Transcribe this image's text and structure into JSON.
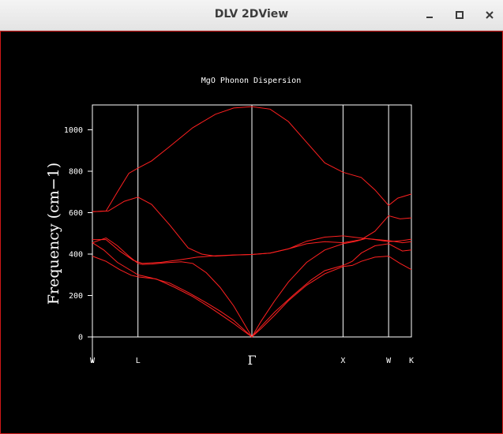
{
  "window": {
    "title": "DLV 2DView",
    "controls": {
      "minimize": "minimize-icon",
      "maximize": "maximize-icon",
      "close": "close-icon"
    }
  },
  "colors": {
    "background": "#000000",
    "axes": "#ffffff",
    "series": "#ff2020",
    "frame_border": "#d01818"
  },
  "chart_data": {
    "type": "line",
    "title": "MgO Phonon Dispersion",
    "xlabel": "",
    "ylabel": "Frequency (cm−1)",
    "xlim": [
      0,
      7
    ],
    "ylim": [
      0,
      1120
    ],
    "yticks": [
      0,
      200,
      400,
      600,
      800,
      1000
    ],
    "grid": false,
    "high_symmetry_points": [
      {
        "label": "W",
        "x": 0
      },
      {
        "label": "L",
        "x": 1
      },
      {
        "label": "Γ",
        "x": 3.5
      },
      {
        "label": "X",
        "x": 5.5
      },
      {
        "label": "W",
        "x": 6.5
      },
      {
        "label": "K",
        "x": 7
      }
    ],
    "series": [
      {
        "values": [
          [
            0,
            605
          ],
          [
            0.3,
            608
          ],
          [
            0.55,
            700
          ],
          [
            0.8,
            790
          ],
          [
            1,
            815
          ],
          [
            1.3,
            850
          ],
          [
            1.7,
            920
          ],
          [
            2.2,
            1010
          ],
          [
            2.7,
            1075
          ],
          [
            3.1,
            1105
          ],
          [
            3.5,
            1112
          ],
          [
            3.9,
            1100
          ],
          [
            4.3,
            1040
          ],
          [
            4.7,
            940
          ],
          [
            5.1,
            840
          ],
          [
            5.5,
            795
          ],
          [
            5.9,
            770
          ],
          [
            6.2,
            710
          ],
          [
            6.5,
            635
          ],
          [
            6.7,
            670
          ],
          [
            7,
            690
          ]
        ]
      },
      {
        "values": [
          [
            0,
            605
          ],
          [
            0.35,
            608
          ],
          [
            0.7,
            655
          ],
          [
            1,
            675
          ],
          [
            1.3,
            640
          ],
          [
            1.7,
            540
          ],
          [
            2.1,
            430
          ],
          [
            2.4,
            400
          ],
          [
            2.7,
            390
          ],
          [
            3.1,
            395
          ],
          [
            3.5,
            398
          ],
          [
            3.9,
            405
          ],
          [
            4.3,
            425
          ],
          [
            4.7,
            450
          ],
          [
            5.1,
            460
          ],
          [
            5.5,
            455
          ],
          [
            5.9,
            470
          ],
          [
            6.2,
            510
          ],
          [
            6.5,
            585
          ],
          [
            6.75,
            570
          ],
          [
            7,
            575
          ]
        ]
      },
      {
        "values": [
          [
            0,
            470
          ],
          [
            0.3,
            470
          ],
          [
            0.6,
            415
          ],
          [
            0.9,
            370
          ],
          [
            1.1,
            355
          ],
          [
            1.5,
            360
          ],
          [
            1.9,
            372
          ],
          [
            2.3,
            385
          ],
          [
            2.7,
            392
          ],
          [
            3.1,
            396
          ],
          [
            3.5,
            398
          ],
          [
            3.9,
            405
          ],
          [
            4.3,
            425
          ],
          [
            4.7,
            462
          ],
          [
            5.1,
            482
          ],
          [
            5.5,
            488
          ],
          [
            5.8,
            480
          ],
          [
            6.2,
            470
          ],
          [
            6.5,
            460
          ],
          [
            6.8,
            465
          ],
          [
            7,
            472
          ]
        ]
      },
      {
        "values": [
          [
            0,
            455
          ],
          [
            0.3,
            478
          ],
          [
            0.55,
            440
          ],
          [
            0.8,
            390
          ],
          [
            1,
            355
          ],
          [
            1.1,
            350
          ],
          [
            1.3,
            352
          ],
          [
            1.6,
            358
          ],
          [
            1.95,
            363
          ],
          [
            2.2,
            355
          ],
          [
            2.5,
            310
          ],
          [
            2.8,
            240
          ],
          [
            3.1,
            150
          ],
          [
            3.3,
            75
          ],
          [
            3.5,
            0
          ],
          [
            3.7,
            75
          ],
          [
            4,
            175
          ],
          [
            4.3,
            265
          ],
          [
            4.7,
            360
          ],
          [
            5.1,
            420
          ],
          [
            5.5,
            450
          ],
          [
            5.75,
            460
          ],
          [
            6,
            475
          ],
          [
            6.25,
            470
          ],
          [
            6.5,
            465
          ],
          [
            6.8,
            455
          ],
          [
            7,
            460
          ]
        ]
      },
      {
        "values": [
          [
            0,
            455
          ],
          [
            0.25,
            420
          ],
          [
            0.55,
            360
          ],
          [
            0.85,
            320
          ],
          [
            1,
            300
          ],
          [
            1.3,
            285
          ],
          [
            1.7,
            260
          ],
          [
            2.1,
            215
          ],
          [
            2.5,
            165
          ],
          [
            2.8,
            125
          ],
          [
            3.1,
            80
          ],
          [
            3.3,
            40
          ],
          [
            3.5,
            0
          ],
          [
            3.7,
            50
          ],
          [
            4,
            120
          ],
          [
            4.4,
            200
          ],
          [
            4.8,
            275
          ],
          [
            5.1,
            320
          ],
          [
            5.5,
            345
          ],
          [
            5.7,
            365
          ],
          [
            5.9,
            405
          ],
          [
            6.2,
            440
          ],
          [
            6.5,
            450
          ],
          [
            6.8,
            415
          ],
          [
            7,
            420
          ]
        ]
      },
      {
        "values": [
          [
            0,
            390
          ],
          [
            0.3,
            365
          ],
          [
            0.6,
            325
          ],
          [
            0.85,
            298
          ],
          [
            1,
            290
          ],
          [
            1.4,
            280
          ],
          [
            1.8,
            240
          ],
          [
            2.2,
            195
          ],
          [
            2.6,
            140
          ],
          [
            2.9,
            95
          ],
          [
            3.1,
            65
          ],
          [
            3.3,
            32
          ],
          [
            3.5,
            0
          ],
          [
            3.7,
            40
          ],
          [
            4,
            105
          ],
          [
            4.3,
            175
          ],
          [
            4.7,
            250
          ],
          [
            5.1,
            305
          ],
          [
            5.5,
            340
          ],
          [
            5.7,
            345
          ],
          [
            5.9,
            365
          ],
          [
            6.2,
            385
          ],
          [
            6.5,
            390
          ],
          [
            6.75,
            355
          ],
          [
            7,
            325
          ]
        ]
      }
    ]
  }
}
